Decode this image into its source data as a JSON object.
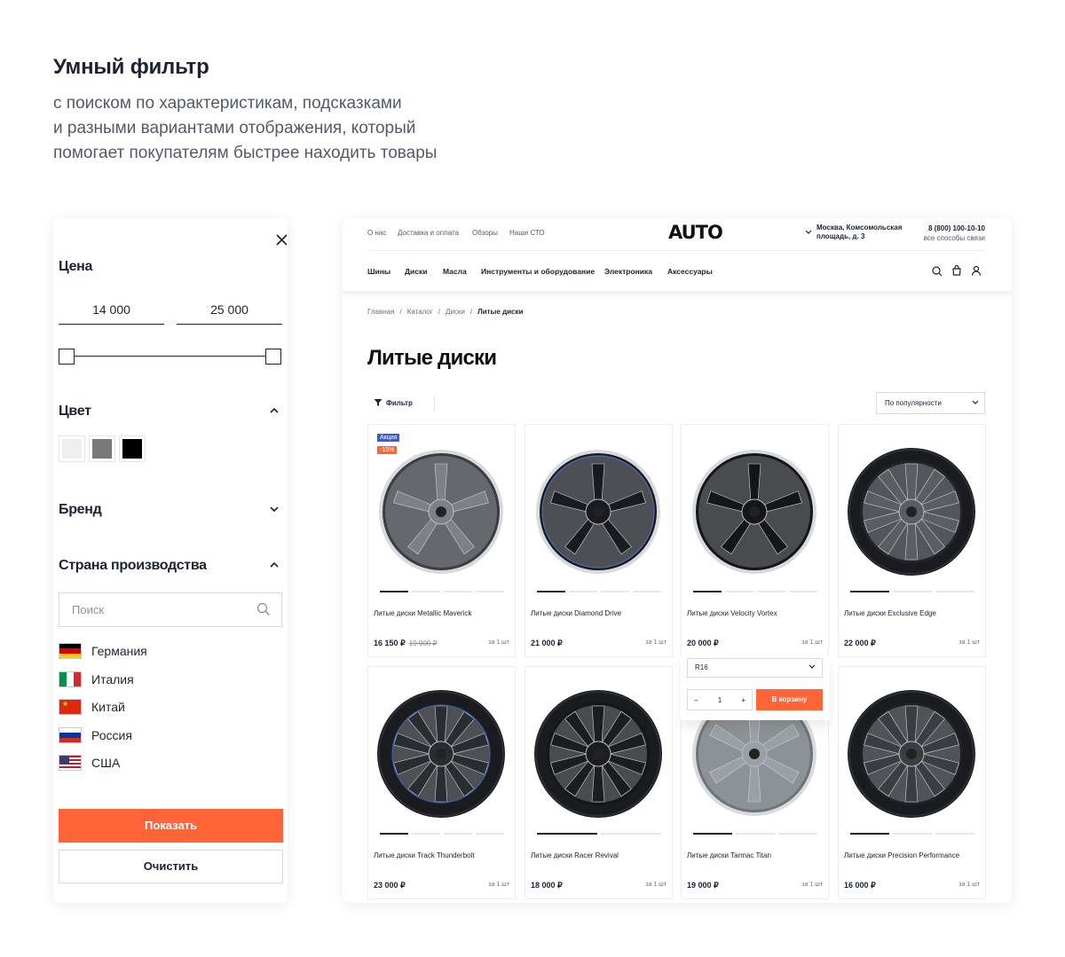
{
  "intro": {
    "title": "Умный фильтр",
    "lines": [
      "с поиском по характеристикам, подсказками",
      "и разными вариантами отображения, который",
      "помогает покупателям быстрее находить товары"
    ]
  },
  "filter": {
    "price": {
      "title": "Цена",
      "min": "14 000",
      "max": "25 000"
    },
    "color": {
      "title": "Цвет",
      "swatches": [
        "#eef0f0",
        "#7a7a7a",
        "#000000"
      ]
    },
    "brand": {
      "title": "Бренд"
    },
    "country": {
      "title": "Страна производства",
      "search_placeholder": "Поиск",
      "items": [
        "Германия",
        "Италия",
        "Китай",
        "Россия",
        "США"
      ]
    },
    "show_button": "Показать",
    "clear_button": "Очистить"
  },
  "store": {
    "top_links": [
      "О нас",
      "Доставка и оплата",
      "Обзоры",
      "Наши СТО"
    ],
    "logo": "AUTO",
    "address_line1": "Москва, Комсомольская",
    "address_line2": "площадь, д. 3",
    "phone": "8 (800) 100-10-10",
    "phone_sub": "все способы связи",
    "categories": [
      "Шины",
      "Диски",
      "Масла",
      "Инструменты и оборудование",
      "Электроника",
      "Аксессуары"
    ],
    "breadcrumbs": [
      "Главная",
      "Каталог",
      "Диски",
      "Литые диски"
    ],
    "page_title": "Литые диски",
    "filter_label": "Фильтр",
    "sort_label": "По популярности",
    "unit_label": "за 1 шт",
    "products": [
      {
        "name": "Литые диски Metallic Maverick",
        "price": "16 150 ₽",
        "old_price": "19 000 ₽",
        "badge_sale": "Акция",
        "badge_discount": "-15%"
      },
      {
        "name": "Литые диски Diamond Drive",
        "price": "21 000 ₽"
      },
      {
        "name": "Литые диски Velocity Vortex",
        "price": "20 000 ₽"
      },
      {
        "name": "Литые диски Exclusive Edge",
        "price": "22 000 ₽"
      },
      {
        "name": "Литые диски Track Thunderbolt",
        "price": "23 000 ₽"
      },
      {
        "name": "Литые диски Racer Revival",
        "price": "18 000 ₽"
      },
      {
        "name": "Литые диски Tarmac Titan",
        "price": "19 000 ₽"
      },
      {
        "name": "Литые диски Precision Performance",
        "price": "16 000 ₽"
      }
    ],
    "hover_card": {
      "size": "R16",
      "qty": "1",
      "qty_minus": "−",
      "qty_plus": "+",
      "cart_button": "В корзину"
    }
  },
  "colors": {
    "accent": "#ff6438",
    "text": "#1e2235",
    "badge_blue": "#3c5bdc"
  }
}
